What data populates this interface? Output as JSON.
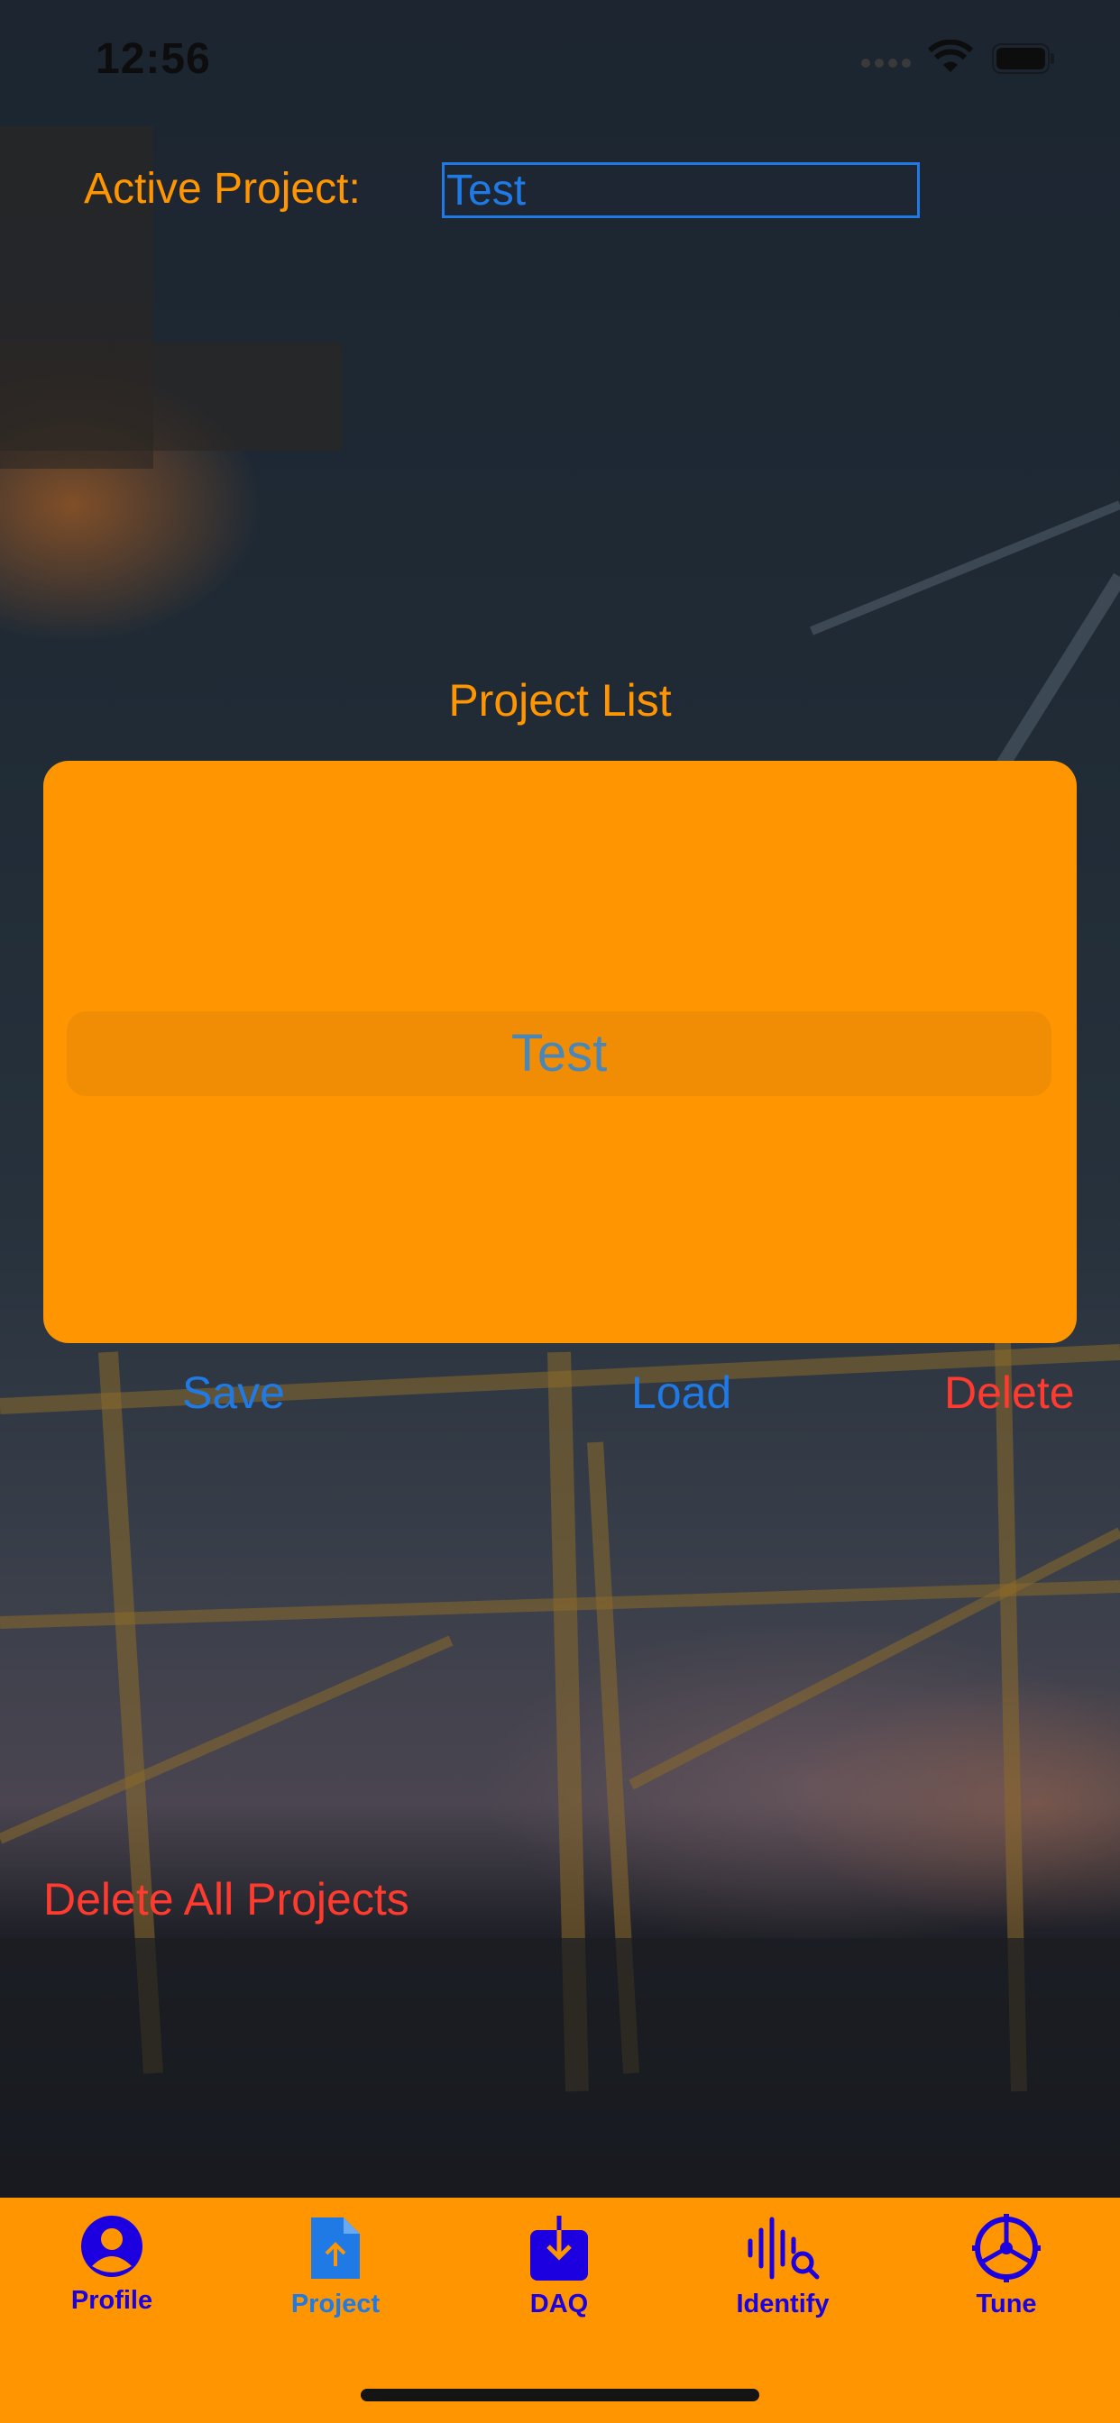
{
  "status_bar": {
    "time": "12:56"
  },
  "header": {
    "active_project_label": "Active Project:",
    "active_project_value": "Test"
  },
  "project_list": {
    "title": "Project List",
    "items": [
      "Test"
    ],
    "selected": "Test"
  },
  "actions": {
    "save_label": "Save",
    "load_label": "Load",
    "delete_label": "Delete",
    "delete_all_label": "Delete All Projects"
  },
  "tabbar": {
    "tabs": [
      {
        "label": "Profile",
        "icon": "person-circle-icon"
      },
      {
        "label": "Project",
        "icon": "document-upload-icon",
        "selected": true
      },
      {
        "label": "DAQ",
        "icon": "download-tray-icon"
      },
      {
        "label": "Identify",
        "icon": "waveform-search-icon"
      },
      {
        "label": "Tune",
        "icon": "steering-wheel-icon"
      }
    ]
  },
  "colors": {
    "accent_orange": "#ff9500",
    "link_blue": "#1f7ae6",
    "destructive_red": "#ff3b30",
    "tab_icon_blue": "#1c00e0"
  }
}
